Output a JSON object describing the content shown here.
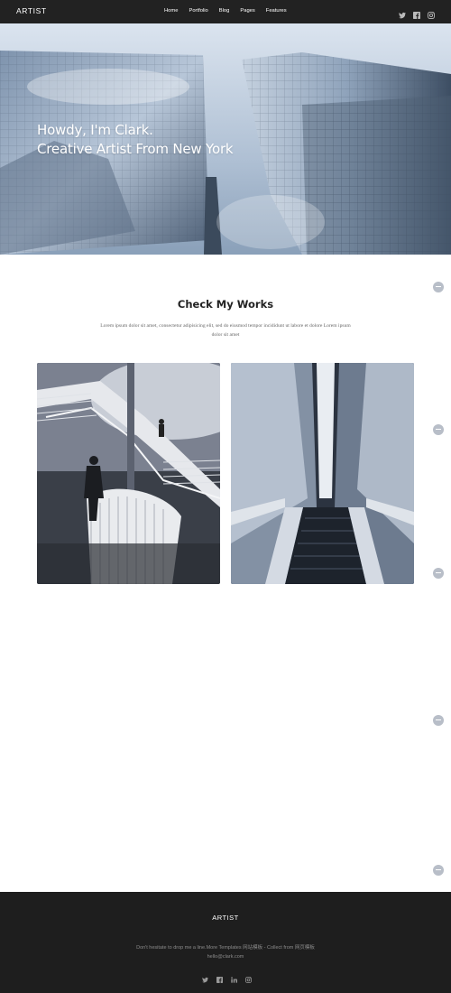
{
  "header": {
    "brand": "ARTIST",
    "nav": [
      "Home",
      "Portfolio",
      "Blog",
      "Pages",
      "Features"
    ],
    "social_icons": [
      "twitter-icon",
      "facebook-icon",
      "instagram-icon"
    ]
  },
  "hero": {
    "line1": "Howdy, I'm Clark.",
    "line2": "Creative Artist From New York"
  },
  "works": {
    "title": "Check My Works",
    "subtitle": "Lorem ipsum dolor sit amet, consectetur adipisicing elit, sed do eiusmod tempor incididunt ut labore et dolore Lorem ipsum dolor sit amet"
  },
  "footer": {
    "brand": "ARTIST",
    "line": "Don't hesitate to drop me a line.More Templates 网站模板 - Collect from 网页模板",
    "email": "hello@clark.com",
    "social_icons": [
      "twitter-icon",
      "facebook-icon",
      "linkedin-icon",
      "instagram-icon"
    ]
  },
  "colors": {
    "topbar": "#222222",
    "footer": "#1e1e1e",
    "dot": "#b8bec8"
  }
}
